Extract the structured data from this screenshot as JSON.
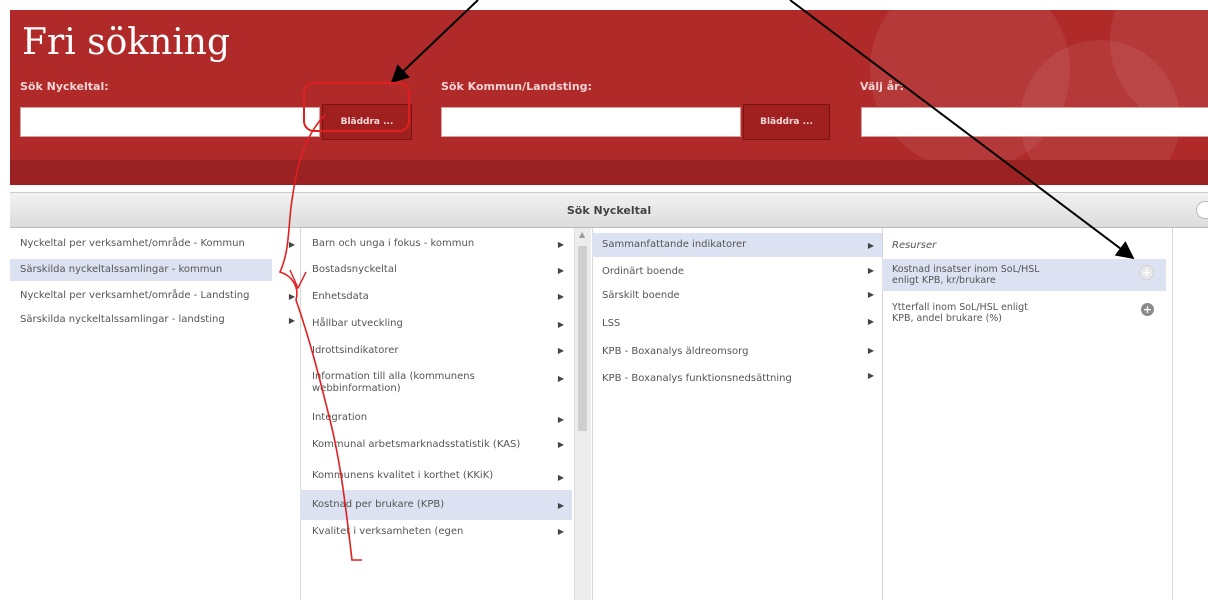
{
  "header": {
    "title": "Fri sökning",
    "search_indicator_label": "Sök Nyckeltal:",
    "search_indicator_value": "",
    "browse1_label": "Bläddra ...",
    "search_municipality_label": "Sök Kommun/Landsting:",
    "search_municipality_value": "",
    "browse2_label": "Bläddra ...",
    "year_label": "Välj år:",
    "year_value": ""
  },
  "panel": {
    "title": "Sök Nyckeltal"
  },
  "col1": {
    "items": [
      {
        "label": "Nyckeltal per verksamhet/område - Kommun"
      },
      {
        "label": "Särskilda nyckeltalssamlingar - kommun"
      },
      {
        "label": "Nyckeltal per verksamhet/område - Landsting"
      },
      {
        "label": "Särskilda nyckeltalssamlingar - landsting"
      }
    ]
  },
  "col2": {
    "items": [
      {
        "label": "Barn och unga i fokus - kommun"
      },
      {
        "label": "Bostadsnyckeltal"
      },
      {
        "label": "Enhetsdata"
      },
      {
        "label": "Hållbar utveckling"
      },
      {
        "label": "Idrottsindikatorer"
      },
      {
        "label": "Information till alla (kommunens webbinformation)"
      },
      {
        "label": "Integration"
      },
      {
        "label": "Kommunal arbetsmarknadsstatistik (KAS)"
      },
      {
        "label": "Kommunens kvalitet i korthet (KKiK)"
      },
      {
        "label": "Kostnad per brukare (KPB)"
      },
      {
        "label": "Kvalitet i verksamheten (egen"
      }
    ]
  },
  "col3": {
    "items": [
      {
        "label": "Sammanfattande indikatorer"
      },
      {
        "label": "Ordinärt boende"
      },
      {
        "label": "Särskilt boende"
      },
      {
        "label": "LSS"
      },
      {
        "label": "KPB - Boxanalys äldreomsorg"
      },
      {
        "label": "KPB - Boxanalys funktionsnedsättning"
      }
    ]
  },
  "col4": {
    "heading": "Resurser",
    "items": [
      {
        "label": "Kostnad insatser inom SoL/HSL enligt KPB, kr/brukare"
      },
      {
        "label": "Ytterfall inom SoL/HSL enligt KPB, andel brukare (%)"
      }
    ]
  },
  "colors": {
    "header_red": "#b02a2a",
    "selected_row": "#dde2f2",
    "annotation_red": "#e02020",
    "annotation_black": "#000000"
  }
}
